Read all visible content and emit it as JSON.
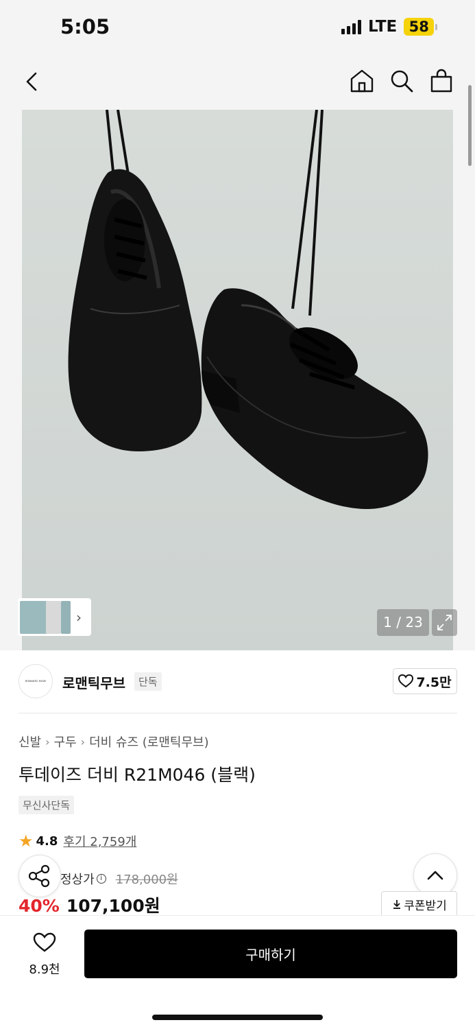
{
  "status_bar": {
    "time": "5:05",
    "network": "LTE",
    "battery": "58"
  },
  "nav": {
    "back_icon": "chevron-left-icon",
    "home_icon": "home-icon",
    "search_icon": "search-icon",
    "bag_icon": "shopping-bag-icon"
  },
  "gallery": {
    "counter": "1 / 23",
    "expand_icon": "expand-icon",
    "thumb_next_icon": "chevron-right-icon"
  },
  "brand": {
    "logo_text": "ROMANTIC MOVE",
    "name": "로맨틱무브",
    "tag": "단독",
    "like_count": "7.5만"
  },
  "product": {
    "breadcrumb": [
      "신발",
      "구두",
      "더비 슈즈 (로맨틱무브)"
    ],
    "title": "투데이즈 더비 R21M046 (블랙)",
    "exclusive_tag": "무신사단독",
    "rating": "4.8",
    "reviews": "후기 2,759개",
    "original_price_label": "정상가",
    "original_price": "178,000원",
    "discount": "40%",
    "sale_price": "107,100원",
    "coupon_label": "쿠폰받기"
  },
  "bottom_bar": {
    "wish_count": "8.9천",
    "buy_label": "구매하기"
  },
  "colors": {
    "accent_red": "#e3262d",
    "star": "#f5a524",
    "battery": "#f5d20a",
    "image_bg": "#d2d8d5"
  }
}
